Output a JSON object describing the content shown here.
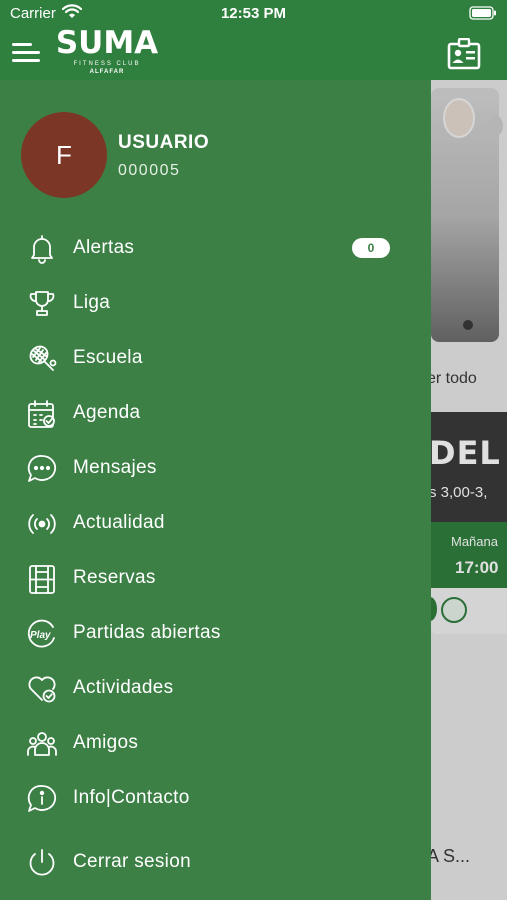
{
  "status_bar": {
    "carrier": "Carrier",
    "time": "12:53 PM"
  },
  "header": {
    "brand": "SUMA",
    "brand_sub": "FITNESS CLUB",
    "brand_location": "ALFAFAR"
  },
  "user": {
    "initial": "F",
    "name": "USUARIO",
    "id": "000005"
  },
  "menu": [
    {
      "label": "Alertas",
      "icon": "bell-icon",
      "badge": "0"
    },
    {
      "label": "Liga",
      "icon": "trophy-icon"
    },
    {
      "label": "Escuela",
      "icon": "racket-icon"
    },
    {
      "label": "Agenda",
      "icon": "calendar-check-icon"
    },
    {
      "label": "Mensajes",
      "icon": "chat-bubble-icon"
    },
    {
      "label": "Actualidad",
      "icon": "broadcast-icon"
    },
    {
      "label": "Reservas",
      "icon": "court-icon"
    },
    {
      "label": "Partidas abiertas",
      "icon": "play-icon"
    },
    {
      "label": "Actividades",
      "icon": "heart-check-icon"
    },
    {
      "label": "Amigos",
      "icon": "people-icon"
    },
    {
      "label": "Info|Contacto",
      "icon": "info-bubble-icon"
    },
    {
      "label": "Cerrar sesion",
      "icon": "power-icon"
    }
  ],
  "background": {
    "see_all": "er todo",
    "card_title": "DEL",
    "card_price": "s 3,00-3,",
    "card_day": "Mañana",
    "card_time": "17:00",
    "bottom_text": "A S..."
  },
  "colors": {
    "primary": "#2f7f3e",
    "drawer": "#3c8046",
    "avatar": "#7b3625"
  }
}
